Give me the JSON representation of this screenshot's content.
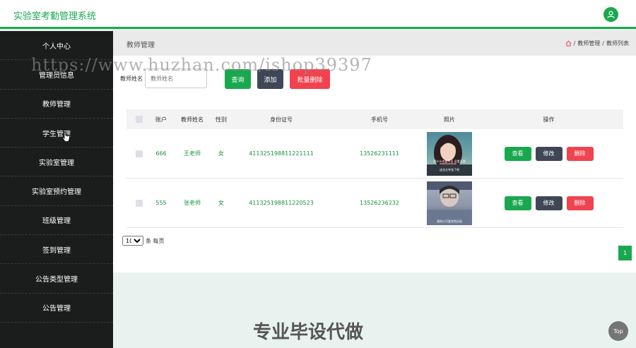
{
  "header": {
    "app_title": "实验室考勤管理系统"
  },
  "sidebar": {
    "items": [
      {
        "label": "个人中心"
      },
      {
        "label": "管理员信息"
      },
      {
        "label": "教师管理"
      },
      {
        "label": "学生管理"
      },
      {
        "label": "实验室管理"
      },
      {
        "label": "实验室预约管理"
      },
      {
        "label": "班级管理"
      },
      {
        "label": "签到管理"
      },
      {
        "label": "公告类型管理"
      },
      {
        "label": "公告管理"
      }
    ]
  },
  "page": {
    "title": "教师管理",
    "breadcrumb": {
      "sep": "/",
      "parent": "教师管理",
      "current": "教师列表"
    }
  },
  "search": {
    "label": "教师姓名",
    "placeholder": "教师姓名",
    "value": ""
  },
  "toolbar": {
    "query_label": "查询",
    "add_label": "添加",
    "batch_delete_label": "批量删除"
  },
  "table": {
    "columns": [
      "账户",
      "教师姓名",
      "性别",
      "身份证号",
      "手机号",
      "照片",
      "操作"
    ],
    "rows": [
      {
        "account": "666",
        "name": "王老师",
        "gender": "女",
        "id_card": "411325198811221111",
        "phone": "13526231111",
        "photo_caption": "我什么也看不见 没看见我",
        "photo_caption2": "这也太夸张了吧"
      },
      {
        "account": "555",
        "name": "张老师",
        "gender": "女",
        "id_card": "411325198811220523",
        "phone": "13526236232",
        "photo_caption": "我的小可爱突然出现"
      }
    ],
    "actions": {
      "view": "查看",
      "edit": "修改",
      "delete": "删除"
    }
  },
  "pagination": {
    "page_size": "10",
    "per_page_label": "条 每页",
    "current_page": "1"
  },
  "overlay": {
    "watermark": "https://www.huzhan.com/ishop39397",
    "promo": "专业毕设代做",
    "top_label": "Top"
  },
  "colors": {
    "brand": "#1aa84f",
    "danger": "#f0434f",
    "slate": "#3f4757",
    "sidebar_bg": "#1b1d1c"
  }
}
